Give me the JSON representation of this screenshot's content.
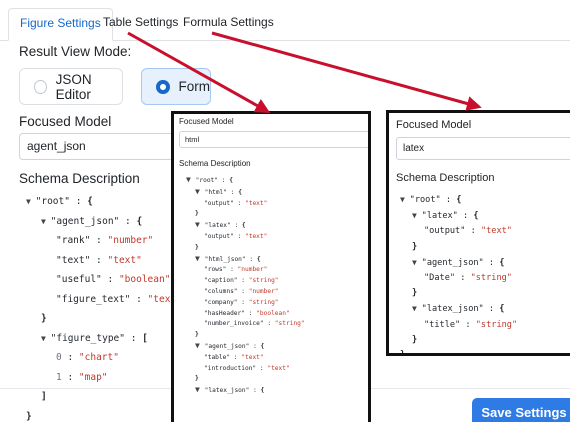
{
  "tabs": [
    "Figure Settings",
    "Table Settings",
    "Formula Settings"
  ],
  "result_view_mode": {
    "label": "Result View Mode:",
    "options": [
      "JSON Editor",
      "Form"
    ],
    "selected": "Form"
  },
  "main": {
    "focused_model_label": "Focused Model",
    "focused_model_value": "agent_json",
    "schema_label": "Schema Description",
    "tree": [
      {
        "d": 0,
        "c": true,
        "k": "\"root\"",
        "t": "{"
      },
      {
        "d": 1,
        "c": true,
        "k": "\"agent_json\"",
        "t": "{"
      },
      {
        "d": 2,
        "k": "\"rank\"",
        "v": "\"number\""
      },
      {
        "d": 2,
        "k": "\"text\"",
        "v": "\"text\""
      },
      {
        "d": 2,
        "k": "\"useful\"",
        "v": "\"boolean\""
      },
      {
        "d": 2,
        "k": "\"figure_text\"",
        "v": "\"text\""
      },
      {
        "d": 1,
        "t": "}"
      },
      {
        "d": 1,
        "c": true,
        "k": "\"figure_type\"",
        "t": "["
      },
      {
        "d": 2,
        "i": "0",
        "v": "\"chart\""
      },
      {
        "d": 2,
        "i": "1",
        "v": "\"map\""
      },
      {
        "d": 1,
        "t": "]"
      },
      {
        "d": 0,
        "t": "}"
      }
    ]
  },
  "panel_html": {
    "focused_model_label": "Focused Model",
    "focused_model_value": "html",
    "schema_label": "Schema Description",
    "tree": [
      {
        "d": 0,
        "c": true,
        "k": "\"root\"",
        "t": "{"
      },
      {
        "d": 1,
        "c": true,
        "k": "\"html\"",
        "t": "{"
      },
      {
        "d": 2,
        "k": "\"output\"",
        "v": "\"text\""
      },
      {
        "d": 1,
        "t": "}"
      },
      {
        "d": 1,
        "c": true,
        "k": "\"latex\"",
        "t": "{"
      },
      {
        "d": 2,
        "k": "\"output\"",
        "v": "\"text\""
      },
      {
        "d": 1,
        "t": "}"
      },
      {
        "d": 1,
        "c": true,
        "k": "\"html_json\"",
        "t": "{"
      },
      {
        "d": 2,
        "k": "\"rows\"",
        "v": "\"number\""
      },
      {
        "d": 2,
        "k": "\"caption\"",
        "v": "\"string\""
      },
      {
        "d": 2,
        "k": "\"columns\"",
        "v": "\"number\""
      },
      {
        "d": 2,
        "k": "\"company\"",
        "v": "\"string\""
      },
      {
        "d": 2,
        "k": "\"hasHeader\"",
        "v": "\"boolean\""
      },
      {
        "d": 2,
        "k": "\"number_invoice\"",
        "v": "\"string\""
      },
      {
        "d": 1,
        "t": "}"
      },
      {
        "d": 1,
        "c": true,
        "k": "\"agent_json\"",
        "t": "{"
      },
      {
        "d": 2,
        "k": "\"table\"",
        "v": "\"text\""
      },
      {
        "d": 2,
        "k": "\"introduction\"",
        "v": "\"text\""
      },
      {
        "d": 1,
        "t": "}"
      },
      {
        "d": 1,
        "c": true,
        "k": "\"latex_json\"",
        "t": "{"
      }
    ]
  },
  "panel_latex": {
    "focused_model_label": "Focused Model",
    "focused_model_value": "latex",
    "schema_label": "Schema Description",
    "tree": [
      {
        "d": 0,
        "c": true,
        "k": "\"root\"",
        "t": "{"
      },
      {
        "d": 1,
        "c": true,
        "k": "\"latex\"",
        "t": "{"
      },
      {
        "d": 2,
        "k": "\"output\"",
        "v": "\"text\""
      },
      {
        "d": 1,
        "t": "}"
      },
      {
        "d": 1,
        "c": true,
        "k": "\"agent_json\"",
        "t": "{"
      },
      {
        "d": 2,
        "k": "\"Date\"",
        "v": "\"string\""
      },
      {
        "d": 1,
        "t": "}"
      },
      {
        "d": 1,
        "c": true,
        "k": "\"latex_json\"",
        "t": "{"
      },
      {
        "d": 2,
        "k": "\"title\"",
        "v": "\"string\""
      },
      {
        "d": 1,
        "t": "}"
      },
      {
        "d": 0,
        "t": "}"
      }
    ]
  },
  "save_label": "Save Settings",
  "colors": {
    "accent": "#1668c9",
    "string_value": "#c0392b",
    "arrow": "#c8102e",
    "button": "#2f7be5"
  }
}
